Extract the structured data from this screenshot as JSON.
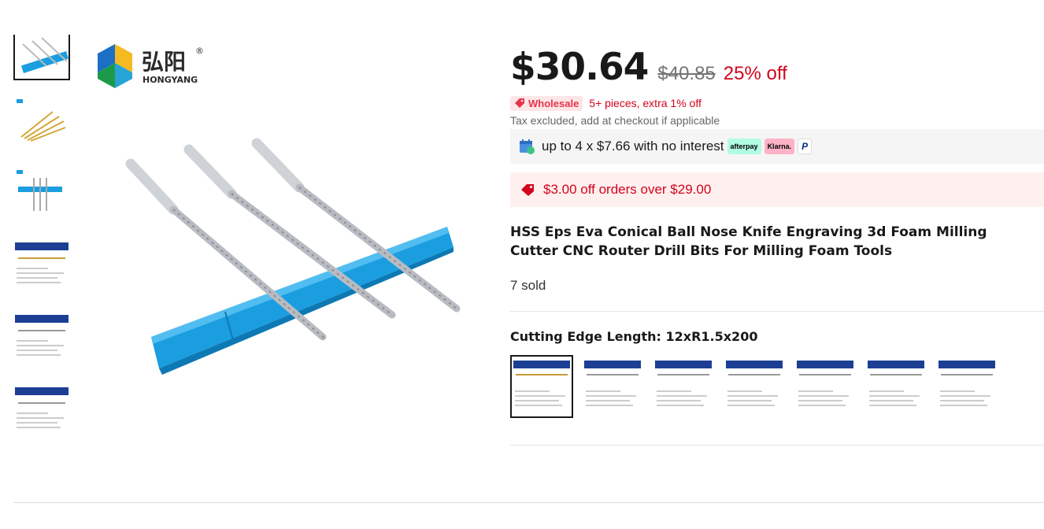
{
  "gallery": {
    "brand_cn": "弘阳",
    "brand_en": "HONGYANG",
    "registered_mark": "®",
    "thumbnails": [
      "bits-on-blue-bar",
      "gold-bits-fan",
      "bits-vertical",
      "spec-sheet-1",
      "spec-sheet-2",
      "spec-sheet-3"
    ],
    "active_index": 0
  },
  "price": {
    "current": "$30.64",
    "original": "$40.85",
    "discount": "25% off"
  },
  "wholesale": {
    "badge": "Wholesale",
    "text": "5+ pieces, extra 1% off"
  },
  "tax_note": "Tax excluded, add at checkout if applicable",
  "installment": {
    "text": "up to 4 x $7.66 with no interest",
    "logos": [
      "afterpay",
      "Klarna.",
      "P"
    ]
  },
  "coupon": {
    "text": "$3.00 off orders over $29.00"
  },
  "product": {
    "title": "HSS Eps Eva Conical Ball Nose Knife Engraving 3d Foam Milling Cutter CNC Router Drill Bits For Milling Foam Tools",
    "sold": "7 sold"
  },
  "sku": {
    "label": "Cutting Edge Length: 12xR1.5x200",
    "options_count": 7,
    "selected_index": 0
  },
  "colors": {
    "accent_red": "#d3031c",
    "blue_bar": "#1a9ee0",
    "text": "#191919"
  }
}
